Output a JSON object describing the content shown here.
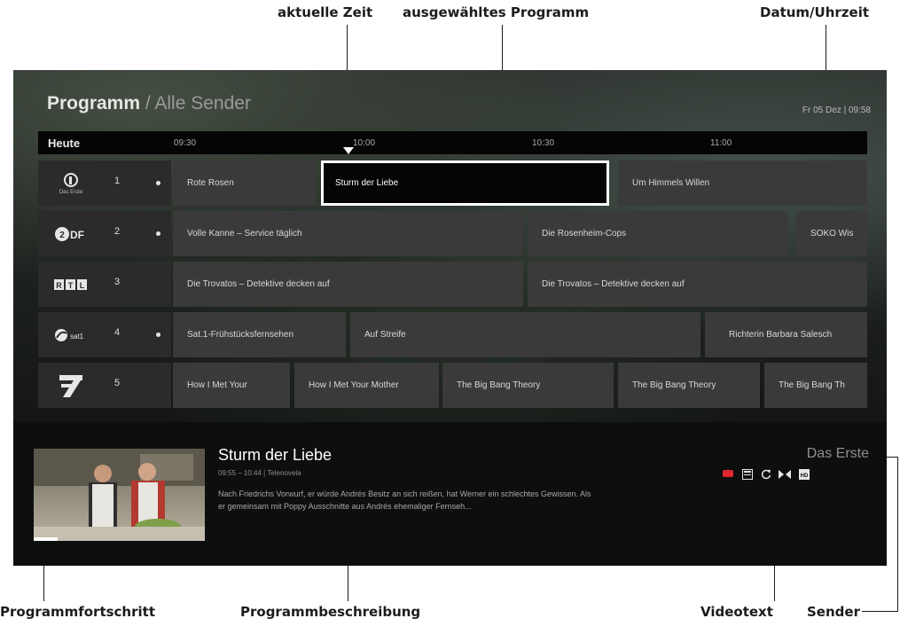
{
  "callouts": {
    "current_time": "aktuelle Zeit",
    "selected_program": "ausgewähltes Programm",
    "datetime": "Datum/Uhrzeit",
    "progress": "Programmfortschritt",
    "description": "Programmbeschreibung",
    "teletext": "Videotext",
    "channel": "Sender"
  },
  "header": {
    "title": "Programm",
    "subtitle": "/ Alle Sender",
    "datetime": "Fr 05 Dez | 09:58"
  },
  "timebar": {
    "today": "Heute",
    "times": [
      "09:30",
      "10:00",
      "10:30",
      "11:00"
    ]
  },
  "channels": [
    {
      "num": "1",
      "logo": "Das Erste",
      "icon": "das-erste-logo"
    },
    {
      "num": "2",
      "logo": "ZDF",
      "icon": "zdf-logo"
    },
    {
      "num": "3",
      "logo": "RTL",
      "icon": "rtl-logo"
    },
    {
      "num": "4",
      "logo": "sat.1",
      "icon": "sat1-logo"
    },
    {
      "num": "5",
      "logo": "7",
      "icon": "pro7-logo"
    }
  ],
  "programs": [
    [
      "Rote Rosen",
      "Sturm der Liebe",
      "Um Himmels Willen"
    ],
    [
      "Volle Kanne – Service täglich",
      "Die Rosenheim-Cops",
      "SOKO Wis"
    ],
    [
      "Die Trovatos – Detektive decken auf",
      "Die Trovatos – Detektive decken auf"
    ],
    [
      "Sat.1-Frühstücksfernsehen",
      "Auf Streife",
      "Richterin Barbara Salesch"
    ],
    [
      "How I Met Your",
      "How I Met Your Mother",
      "The Big Bang Theory",
      "The Big Bang Theory",
      "The Big Bang Th"
    ]
  ],
  "info": {
    "title": "Sturm der Liebe",
    "meta": "09:55 – 10:44 | Telenovela",
    "description": "Nach Friedrichs Vorwurf, er würde Andrés Besitz an sich reißen, hat Werner ein schlechtes Gewissen. Als er gemeinsam mit Poppy Ausschnitte aus Andrés ehemaliger Fernseh...",
    "channel": "Das Erste",
    "progress": 0.14,
    "icons": [
      "record-icon",
      "teletext-icon",
      "replay-icon",
      "audio-description-icon",
      "hd-icon"
    ]
  },
  "colors": {
    "record": "#e3262e",
    "accent": "#ffffff"
  }
}
